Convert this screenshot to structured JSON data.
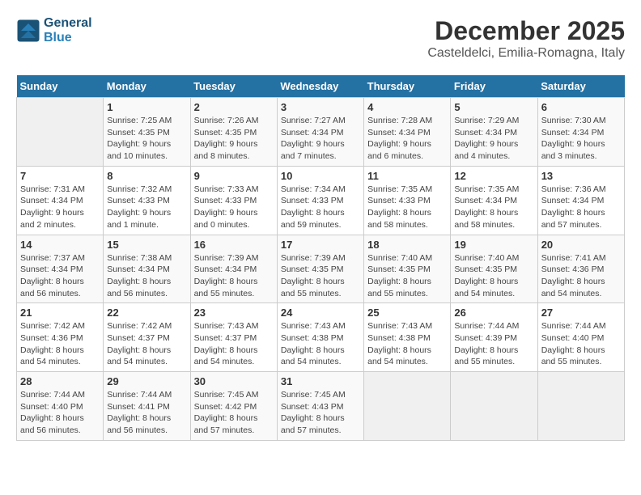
{
  "header": {
    "logo_line1": "General",
    "logo_line2": "Blue",
    "month": "December 2025",
    "location": "Casteldelci, Emilia-Romagna, Italy"
  },
  "weekdays": [
    "Sunday",
    "Monday",
    "Tuesday",
    "Wednesday",
    "Thursday",
    "Friday",
    "Saturday"
  ],
  "weeks": [
    [
      {
        "day": "",
        "info": ""
      },
      {
        "day": "1",
        "info": "Sunrise: 7:25 AM\nSunset: 4:35 PM\nDaylight: 9 hours\nand 10 minutes."
      },
      {
        "day": "2",
        "info": "Sunrise: 7:26 AM\nSunset: 4:35 PM\nDaylight: 9 hours\nand 8 minutes."
      },
      {
        "day": "3",
        "info": "Sunrise: 7:27 AM\nSunset: 4:34 PM\nDaylight: 9 hours\nand 7 minutes."
      },
      {
        "day": "4",
        "info": "Sunrise: 7:28 AM\nSunset: 4:34 PM\nDaylight: 9 hours\nand 6 minutes."
      },
      {
        "day": "5",
        "info": "Sunrise: 7:29 AM\nSunset: 4:34 PM\nDaylight: 9 hours\nand 4 minutes."
      },
      {
        "day": "6",
        "info": "Sunrise: 7:30 AM\nSunset: 4:34 PM\nDaylight: 9 hours\nand 3 minutes."
      }
    ],
    [
      {
        "day": "7",
        "info": "Sunrise: 7:31 AM\nSunset: 4:34 PM\nDaylight: 9 hours\nand 2 minutes."
      },
      {
        "day": "8",
        "info": "Sunrise: 7:32 AM\nSunset: 4:33 PM\nDaylight: 9 hours\nand 1 minute."
      },
      {
        "day": "9",
        "info": "Sunrise: 7:33 AM\nSunset: 4:33 PM\nDaylight: 9 hours\nand 0 minutes."
      },
      {
        "day": "10",
        "info": "Sunrise: 7:34 AM\nSunset: 4:33 PM\nDaylight: 8 hours\nand 59 minutes."
      },
      {
        "day": "11",
        "info": "Sunrise: 7:35 AM\nSunset: 4:33 PM\nDaylight: 8 hours\nand 58 minutes."
      },
      {
        "day": "12",
        "info": "Sunrise: 7:35 AM\nSunset: 4:34 PM\nDaylight: 8 hours\nand 58 minutes."
      },
      {
        "day": "13",
        "info": "Sunrise: 7:36 AM\nSunset: 4:34 PM\nDaylight: 8 hours\nand 57 minutes."
      }
    ],
    [
      {
        "day": "14",
        "info": "Sunrise: 7:37 AM\nSunset: 4:34 PM\nDaylight: 8 hours\nand 56 minutes."
      },
      {
        "day": "15",
        "info": "Sunrise: 7:38 AM\nSunset: 4:34 PM\nDaylight: 8 hours\nand 56 minutes."
      },
      {
        "day": "16",
        "info": "Sunrise: 7:39 AM\nSunset: 4:34 PM\nDaylight: 8 hours\nand 55 minutes."
      },
      {
        "day": "17",
        "info": "Sunrise: 7:39 AM\nSunset: 4:35 PM\nDaylight: 8 hours\nand 55 minutes."
      },
      {
        "day": "18",
        "info": "Sunrise: 7:40 AM\nSunset: 4:35 PM\nDaylight: 8 hours\nand 55 minutes."
      },
      {
        "day": "19",
        "info": "Sunrise: 7:40 AM\nSunset: 4:35 PM\nDaylight: 8 hours\nand 54 minutes."
      },
      {
        "day": "20",
        "info": "Sunrise: 7:41 AM\nSunset: 4:36 PM\nDaylight: 8 hours\nand 54 minutes."
      }
    ],
    [
      {
        "day": "21",
        "info": "Sunrise: 7:42 AM\nSunset: 4:36 PM\nDaylight: 8 hours\nand 54 minutes."
      },
      {
        "day": "22",
        "info": "Sunrise: 7:42 AM\nSunset: 4:37 PM\nDaylight: 8 hours\nand 54 minutes."
      },
      {
        "day": "23",
        "info": "Sunrise: 7:43 AM\nSunset: 4:37 PM\nDaylight: 8 hours\nand 54 minutes."
      },
      {
        "day": "24",
        "info": "Sunrise: 7:43 AM\nSunset: 4:38 PM\nDaylight: 8 hours\nand 54 minutes."
      },
      {
        "day": "25",
        "info": "Sunrise: 7:43 AM\nSunset: 4:38 PM\nDaylight: 8 hours\nand 54 minutes."
      },
      {
        "day": "26",
        "info": "Sunrise: 7:44 AM\nSunset: 4:39 PM\nDaylight: 8 hours\nand 55 minutes."
      },
      {
        "day": "27",
        "info": "Sunrise: 7:44 AM\nSunset: 4:40 PM\nDaylight: 8 hours\nand 55 minutes."
      }
    ],
    [
      {
        "day": "28",
        "info": "Sunrise: 7:44 AM\nSunset: 4:40 PM\nDaylight: 8 hours\nand 56 minutes."
      },
      {
        "day": "29",
        "info": "Sunrise: 7:44 AM\nSunset: 4:41 PM\nDaylight: 8 hours\nand 56 minutes."
      },
      {
        "day": "30",
        "info": "Sunrise: 7:45 AM\nSunset: 4:42 PM\nDaylight: 8 hours\nand 57 minutes."
      },
      {
        "day": "31",
        "info": "Sunrise: 7:45 AM\nSunset: 4:43 PM\nDaylight: 8 hours\nand 57 minutes."
      },
      {
        "day": "",
        "info": ""
      },
      {
        "day": "",
        "info": ""
      },
      {
        "day": "",
        "info": ""
      }
    ]
  ]
}
